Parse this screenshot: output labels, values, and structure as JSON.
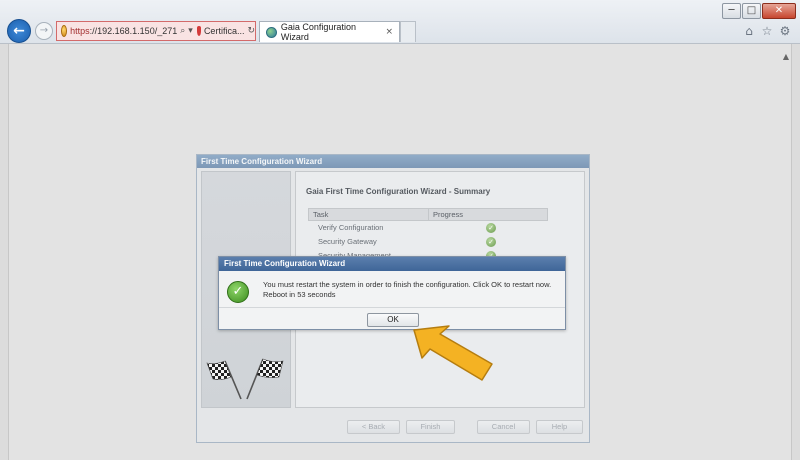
{
  "browser": {
    "address": {
      "https": "https",
      "host": "://192.168.1.150/_271",
      "search_icon": "search-icon",
      "cert_label": "Certifica..."
    },
    "tab": {
      "title": "Gaia Configuration Wizard",
      "close": "×"
    },
    "icons": [
      "home-icon",
      "star-icon",
      "gear-icon"
    ],
    "window_controls": {
      "minimize": "─",
      "maximize": "□",
      "close": "✕"
    }
  },
  "wizard": {
    "window_title": "First Time Configuration Wizard",
    "summary_title": "Gaia First Time Configuration Wizard - Summary",
    "table": {
      "headers": [
        "Task",
        "Progress"
      ],
      "rows": [
        {
          "task": "Verify Configuration",
          "status": "done"
        },
        {
          "task": "Security Gateway",
          "status": "done"
        },
        {
          "task": "Security Management",
          "status": "done"
        }
      ]
    },
    "footer_buttons": [
      "< Back",
      "Finish",
      "Cancel",
      "Help"
    ]
  },
  "dialog": {
    "title": "First Time Configuration Wizard",
    "message_line1": "You must restart the system in order to finish the configuration. Click OK to restart now.",
    "message_line2": "Reboot in 53 seconds",
    "ok_label": "OK"
  },
  "colors": {
    "arrow": "#f4b223",
    "dialog_title": "#4a6fa0",
    "success": "#4c9a2a"
  }
}
